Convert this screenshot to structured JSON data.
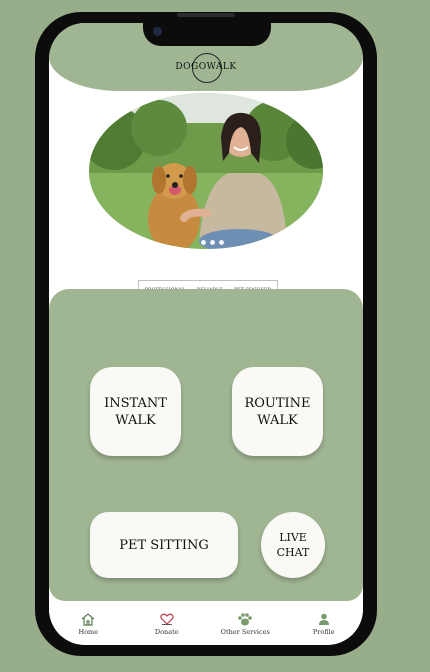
{
  "app": {
    "logo_text": "DOGOWALK"
  },
  "tags": [
    "PROFESSIONAL",
    "RELIABLE",
    "PET FOCUSED"
  ],
  "hero": {
    "image_alt": "Woman with golden retriever in park",
    "slide_count": 3,
    "active_slide": 1
  },
  "services": {
    "instant_walk": "INSTANT WALK",
    "routine_walk": "ROUTINE WALK",
    "pet_sitting": "PET SITTING",
    "live_chat": "LIVE CHAT"
  },
  "nav": [
    {
      "label": "Home",
      "icon": "home-icon"
    },
    {
      "label": "Donate",
      "icon": "heart-icon"
    },
    {
      "label": "Other Services",
      "icon": "paw-icon"
    },
    {
      "label": "Profile",
      "icon": "profile-icon"
    }
  ],
  "colors": {
    "background": "#98ad8a",
    "accent": "#a0b693",
    "heart": "#c0394b"
  }
}
